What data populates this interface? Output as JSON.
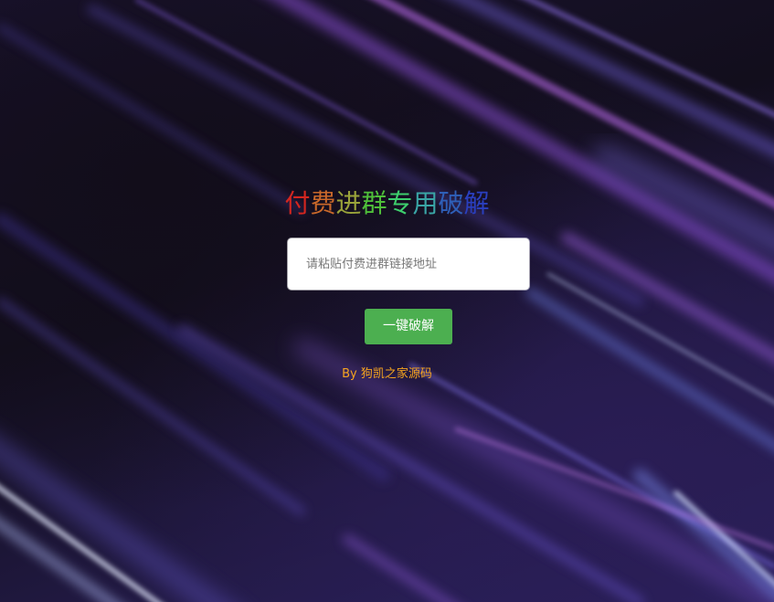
{
  "header": {
    "title_chars": [
      {
        "text": "付",
        "color": "#d4261f"
      },
      {
        "text": "费",
        "color": "#c9682a"
      },
      {
        "text": "进",
        "color": "#9aa33a"
      },
      {
        "text": "群",
        "color": "#4fbf3a"
      },
      {
        "text": "专",
        "color": "#3ecf6d"
      },
      {
        "text": "用",
        "color": "#3aa5a6"
      },
      {
        "text": "破",
        "color": "#2e5fb8"
      },
      {
        "text": "解",
        "color": "#2a3fbf"
      }
    ]
  },
  "form": {
    "link_input": {
      "value": "",
      "placeholder": "请粘贴付费进群链接地址"
    },
    "submit_label": "一键破解"
  },
  "footer": {
    "credit": "By 狗凯之家源码",
    "credit_color": "#f5a41f"
  },
  "colors": {
    "button": "#4caf50",
    "background": "#14101f"
  }
}
